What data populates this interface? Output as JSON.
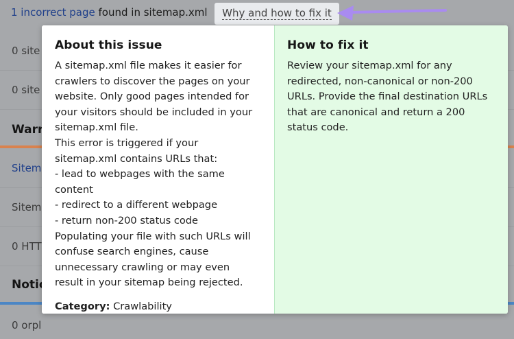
{
  "issue_line": {
    "count_link": "1 incorrect page",
    "rest": " found in sitemap.xml",
    "why_label": "Why and how to fix it"
  },
  "background": {
    "rows": [
      {
        "text": "0 site"
      },
      {
        "text": "0 site"
      },
      {
        "text": "Sitem"
      },
      {
        "text": "Sitem"
      },
      {
        "text": "0 HTT"
      },
      {
        "text": "0 orpl"
      }
    ],
    "headers": [
      {
        "text": "Warr"
      },
      {
        "text": "Notic"
      }
    ],
    "colors": {
      "warning_bar": "#d9824e",
      "notice_bar": "#4b86c5"
    }
  },
  "popup": {
    "about": {
      "title": "About this issue",
      "lines": [
        "A sitemap.xml file makes it easier for",
        "crawlers to discover the pages on your",
        "website. Only good pages intended for",
        "your visitors should be included in your",
        "sitemap.xml file.",
        "This error is triggered if your",
        "sitemap.xml contains URLs that:",
        "- lead to webpages with the same",
        "content",
        "- redirect to a different webpage",
        "- return non-200 status code",
        "Populating your file with such URLs will",
        "confuse search engines, cause",
        "unnecessary crawling or may even",
        "result in your sitemap being rejected."
      ],
      "category_label": "Category:",
      "category_value": " Crawlability"
    },
    "fix": {
      "title": "How to fix it",
      "lines": [
        "Review your sitemap.xml for any",
        "redirected, non-canonical or non-200",
        "URLs. Provide the final destination URLs",
        "that are canonical and return a 200",
        "status code."
      ]
    }
  },
  "arrow_color": "#a98bf0"
}
